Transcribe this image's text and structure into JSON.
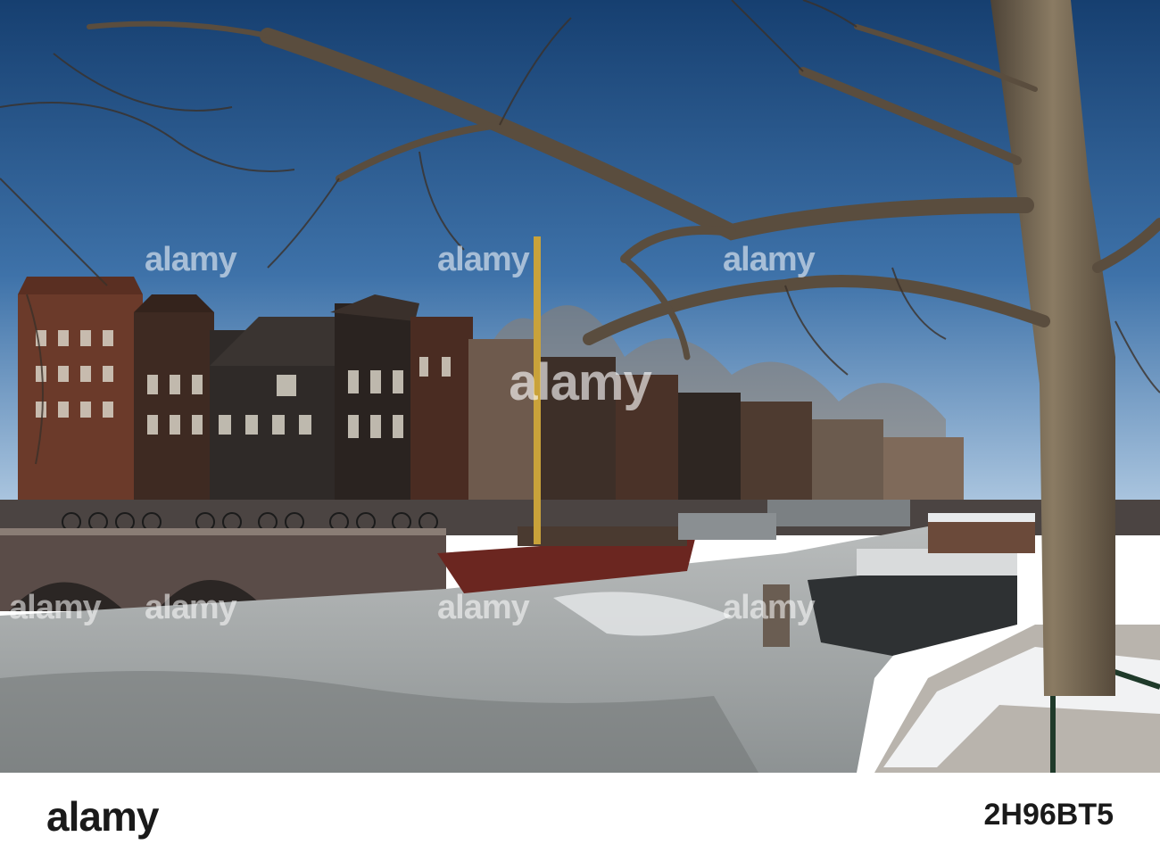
{
  "watermark": {
    "brand": "alamy",
    "repeat_label": "alamy"
  },
  "footer": {
    "logo_text": "alamy",
    "image_id": "2H96BT5"
  },
  "colors": {
    "sky_top": "#1f4f86",
    "sky_bottom": "#7ea6cf",
    "ice": "#9ea3a6",
    "tree_bark": "#6f6150",
    "house_brick": "#6a3a2a"
  }
}
